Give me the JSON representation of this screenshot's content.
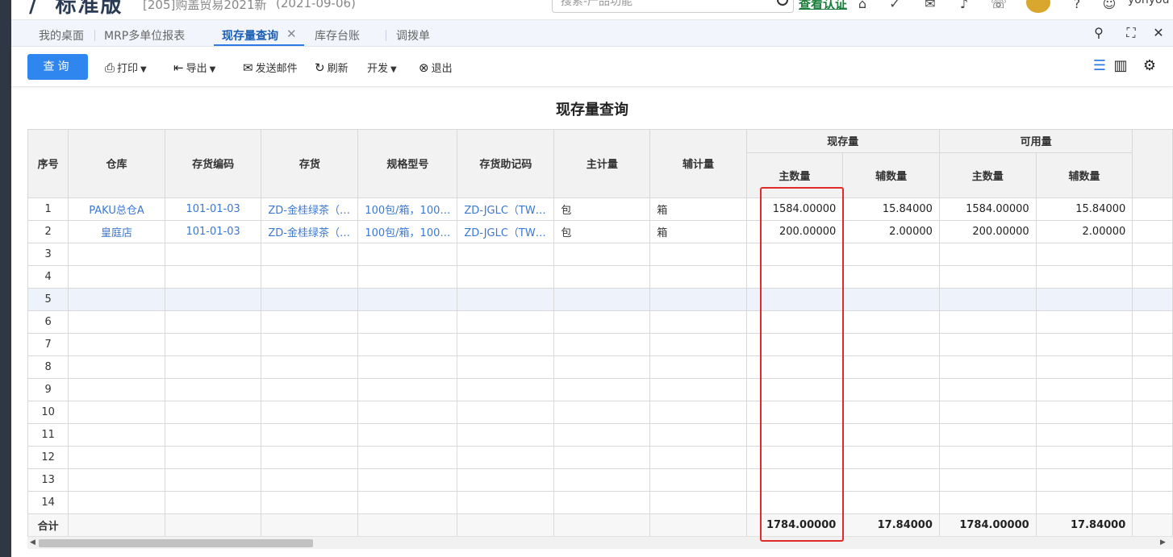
{
  "header": {
    "brand": "标准版",
    "account": "[205]购盖贸易2021新",
    "login_date": "(2021-09-06)",
    "search_placeholder": "搜索-产品功能",
    "auth_link": "查看认证",
    "user": "yonyou"
  },
  "tabs": [
    {
      "label": "我的桌面"
    },
    {
      "label": "MRP多单位报表"
    },
    {
      "label": "现存量查询"
    },
    {
      "label": "库存台账"
    },
    {
      "label": "调拨单"
    }
  ],
  "tab_close": "✕",
  "toolbar": {
    "query": "查询",
    "print": "打印",
    "export": "导出",
    "send_mail": "发送邮件",
    "refresh": "刷新",
    "develop": "开发",
    "exit": "退出"
  },
  "report": {
    "title": "现存量查询"
  },
  "table": {
    "headers": {
      "seq": "序号",
      "warehouse": "仓库",
      "code": "存货编码",
      "item": "存货",
      "spec": "规格型号",
      "mnemonic": "存货助记码",
      "main_unit": "主计量",
      "aux_unit": "辅计量",
      "onhand": "现存量",
      "available": "可用量",
      "main_qty": "主数量",
      "aux_qty": "辅数量"
    },
    "rows": [
      {
        "seq": "1",
        "warehouse": "PAKU总仓A",
        "code": "101-01-03",
        "item": "ZD-金桂绿茶（…",
        "spec": "100包/箱，100…",
        "mnemonic": "ZD-JGLC（TW…",
        "main_unit": "包",
        "aux_unit": "箱",
        "onhand_main": "1584.00000",
        "onhand_aux": "15.84000",
        "avail_main": "1584.00000",
        "avail_aux": "15.84000"
      },
      {
        "seq": "2",
        "warehouse": "皇庭店",
        "code": "101-01-03",
        "item": "ZD-金桂绿茶（…",
        "spec": "100包/箱，100…",
        "mnemonic": "ZD-JGLC（TW…",
        "main_unit": "包",
        "aux_unit": "箱",
        "onhand_main": "200.00000",
        "onhand_aux": "2.00000",
        "avail_main": "200.00000",
        "avail_aux": "2.00000"
      },
      {
        "seq": "3"
      },
      {
        "seq": "4"
      },
      {
        "seq": "5"
      },
      {
        "seq": "6"
      },
      {
        "seq": "7"
      },
      {
        "seq": "8"
      },
      {
        "seq": "9"
      },
      {
        "seq": "10"
      },
      {
        "seq": "11"
      },
      {
        "seq": "12"
      },
      {
        "seq": "13"
      },
      {
        "seq": "14"
      }
    ],
    "total": {
      "label": "合计",
      "onhand_main": "1784.00000",
      "onhand_aux": "17.84000",
      "avail_main": "1784.00000",
      "avail_aux": "17.84000"
    }
  },
  "colors": {
    "accent": "#2f86ee",
    "link": "#3a78d4",
    "highlight_box": "#e02b2b"
  }
}
